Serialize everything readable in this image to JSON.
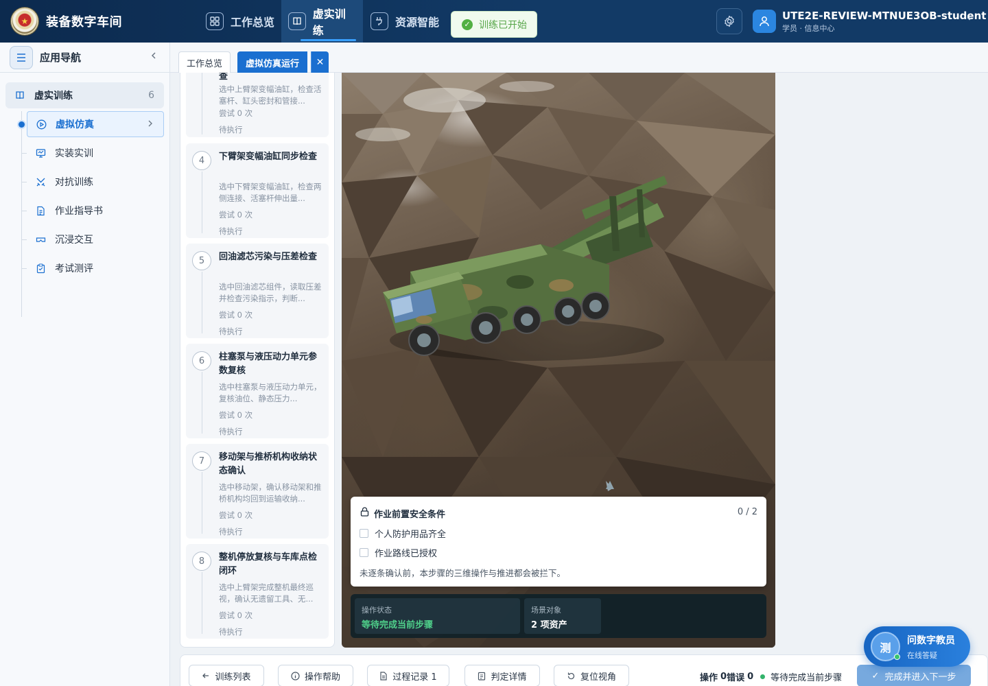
{
  "header": {
    "app_title": "装备数字车间",
    "nav": [
      {
        "label": "工作总览",
        "icon": "grid-icon"
      },
      {
        "label": "虚实训练",
        "icon": "book-icon"
      },
      {
        "label": "资源智能",
        "icon": "plug-icon"
      }
    ],
    "toast": "训练已开始",
    "user": {
      "name": "UTE2E-REVIEW-MTNUE3OB-student",
      "role": "学员 · 信息中心"
    }
  },
  "sidebar": {
    "title": "应用导航",
    "group": {
      "label": "虚实训练",
      "count": "6"
    },
    "items": [
      {
        "label": "虚拟仿真",
        "icon": "play-circle-icon"
      },
      {
        "label": "实装实训",
        "icon": "monitor-icon"
      },
      {
        "label": "对抗训练",
        "icon": "swords-icon"
      },
      {
        "label": "作业指导书",
        "icon": "document-icon"
      },
      {
        "label": "沉浸交互",
        "icon": "vr-headset-icon"
      },
      {
        "label": "考试测评",
        "icon": "clipboard-icon"
      }
    ]
  },
  "tabs": [
    {
      "label": "工作总览"
    },
    {
      "label": "虚拟仿真运行"
    }
  ],
  "steps": {
    "top_fragment": {
      "title_tail": "查",
      "desc": "选中上臂架变幅油缸，检查活塞杆、缸头密封和管接...",
      "tries": "尝试 0 次",
      "state": "待执行"
    },
    "list": [
      {
        "num": "4",
        "title": "下臂架变幅油缸同步检查",
        "desc": "选中下臂架变幅油缸，检查两侧连接、活塞杆伸出量...",
        "tries": "尝试 0 次",
        "state": "待执行"
      },
      {
        "num": "5",
        "title": "回油滤芯污染与压差检查",
        "desc": "选中回油滤芯组件，读取压差并检查污染指示，判断...",
        "tries": "尝试 0 次",
        "state": "待执行"
      },
      {
        "num": "6",
        "title": "柱塞泵与液压动力单元参数复核",
        "desc": "选中柱塞泵与液压动力单元，复核油位、静态压力...",
        "tries": "尝试 0 次",
        "state": "待执行"
      },
      {
        "num": "7",
        "title": "移动架与推桥机构收纳状态确认",
        "desc": "选中移动架，确认移动架和推桥机构均回到运输收纳...",
        "tries": "尝试 0 次",
        "state": "待执行"
      },
      {
        "num": "8",
        "title": "整机停放复核与车库点检闭环",
        "desc": "选中上臂架完成整机最终巡视，确认无遗留工具、无...",
        "tries": "尝试 0 次",
        "state": "待执行"
      }
    ]
  },
  "safety": {
    "title": "作业前置安全条件",
    "count": "0 / 2",
    "items": [
      "个人防护用品齐全",
      "作业路线已授权"
    ],
    "note": "未逐条确认前，本步骤的三维操作与推进都会被拦下。"
  },
  "status": {
    "op_label": "操作状态",
    "op_value": "等待完成当前步骤",
    "op_color": "#4fd08a",
    "scene_label": "场景对象",
    "scene_value": "2 项资产"
  },
  "toolbar": {
    "list_btn": "训练列表",
    "help_btn": "操作帮助",
    "log_btn": "过程记录 1",
    "judge_btn": "判定详情",
    "reset_btn": "复位视角",
    "ops_label": "操作",
    "ops_value": "0",
    "err_label": "错误",
    "err_value": "0",
    "status_text": "等待完成当前步骤",
    "next_btn": "完成并进入下一步"
  },
  "assistant": {
    "avatar_text": "测",
    "title": "问数字教员",
    "subtitle": "在线答疑"
  },
  "colors": {
    "topbar": "#0c2a4e",
    "accent": "#1a6fd0",
    "success": "#52b043",
    "next_btn": "#77a9de"
  }
}
